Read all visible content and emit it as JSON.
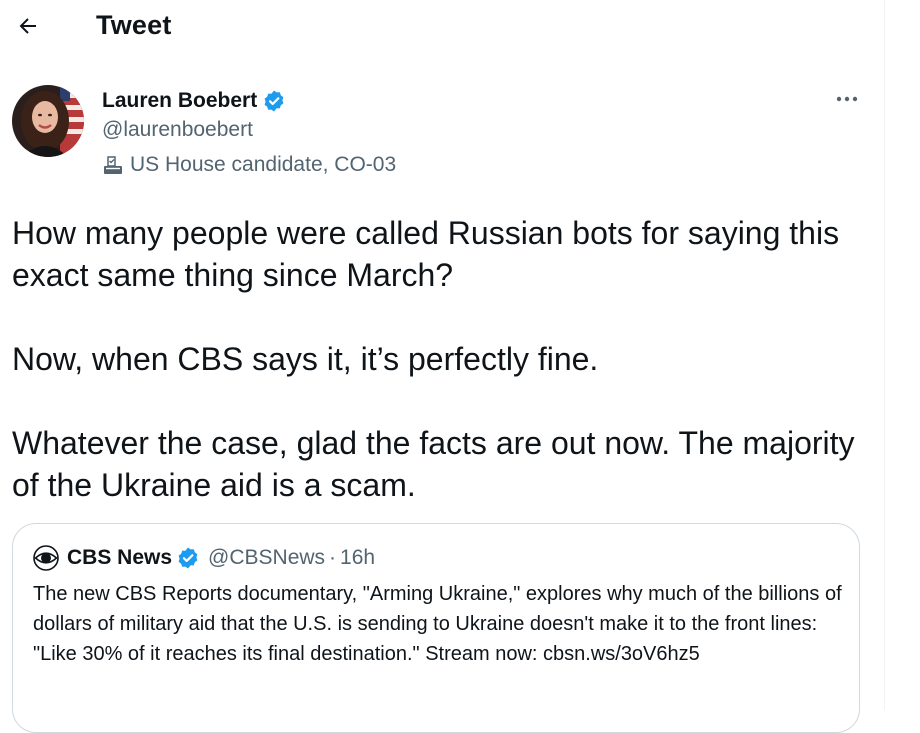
{
  "header": {
    "title": "Tweet",
    "back_icon": "arrow-left-icon"
  },
  "author": {
    "name": "Lauren Boebert",
    "verified": true,
    "handle": "@laurenboebert",
    "label": "US House candidate, CO-03",
    "label_icon": "ballot-box-icon",
    "more_icon": "more-horizontal-icon"
  },
  "tweet": {
    "paragraphs": [
      "How many people were called Russian bots for saying this exact same thing since March?",
      "Now, when CBS says it, it’s perfectly fine.",
      "Whatever the case, glad the facts are out now. The majority of the Ukraine aid is a scam."
    ]
  },
  "quote": {
    "name": "CBS News",
    "verified": true,
    "handle": "@CBSNews",
    "separator": "·",
    "time": "16h",
    "text": "The new CBS Reports documentary, \"Arming Ukraine,\" explores why much of the billions of dollars of military aid that the U.S. is sending to Ukraine doesn't make it to the front lines: \"Like 30% of it reaches its final destination.\" Stream now: cbsn.ws/3oV6hz5"
  },
  "colors": {
    "text": "#0f1419",
    "secondary": "#536471",
    "verified_blue": "#1d9bf0",
    "border": "#cfd9de"
  }
}
